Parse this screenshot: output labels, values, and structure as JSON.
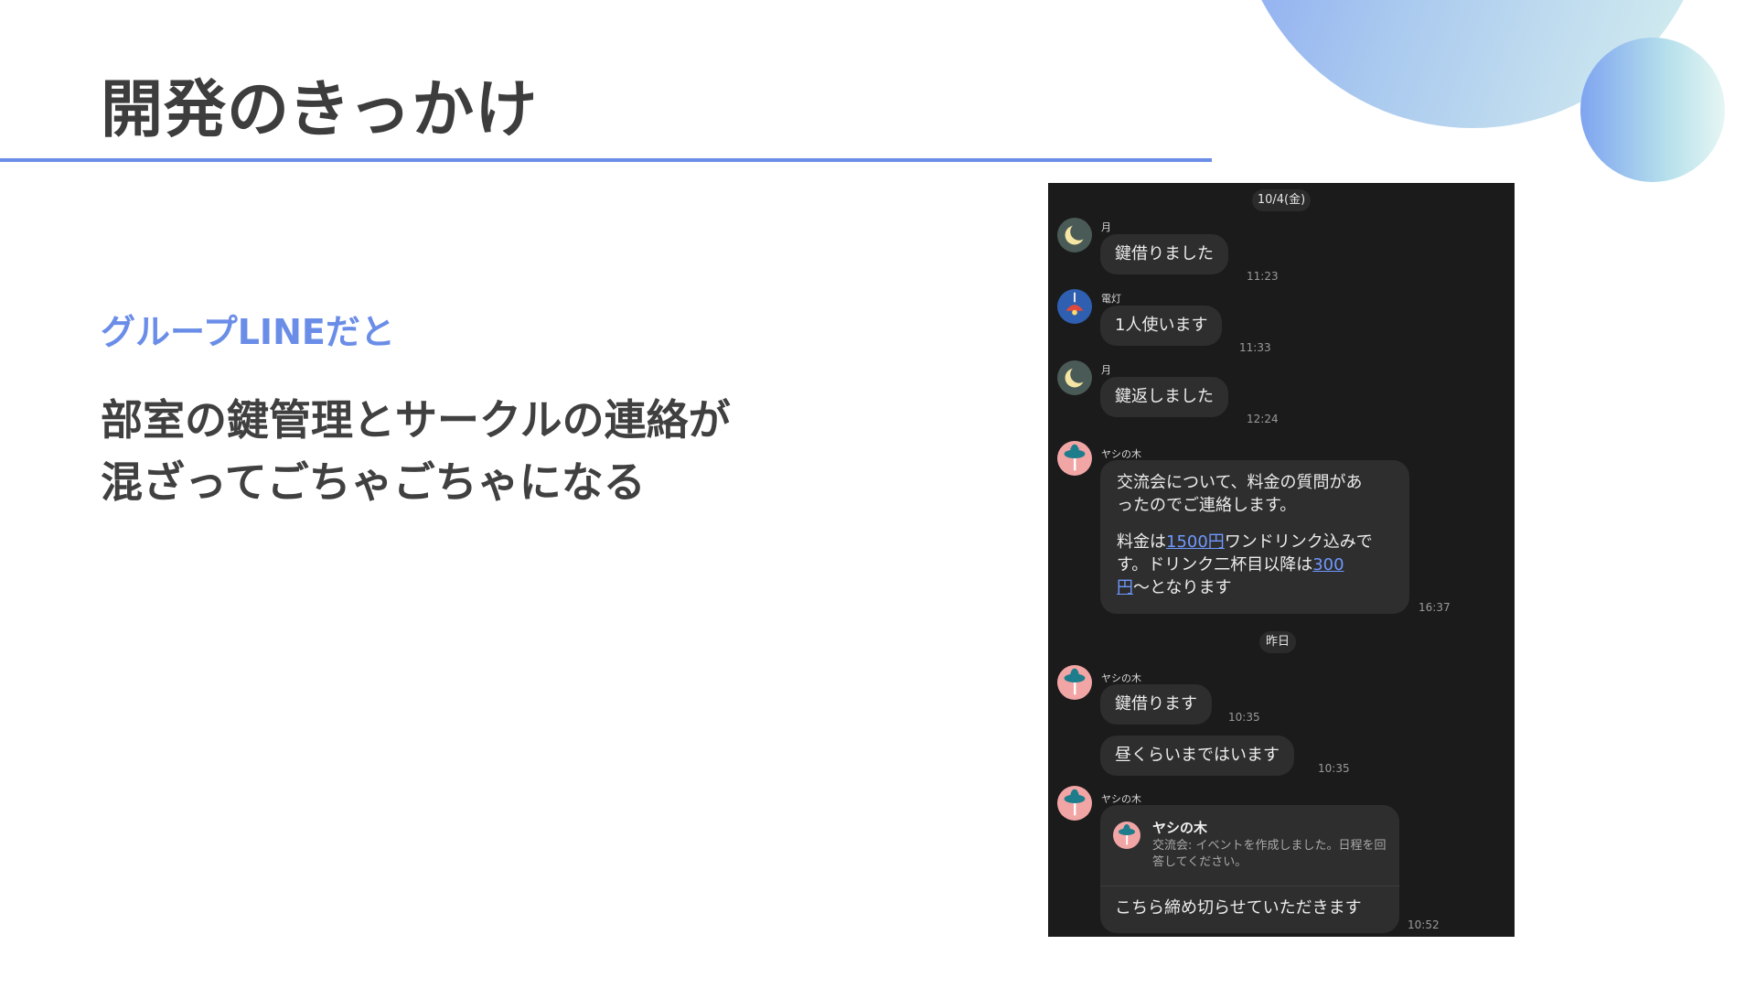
{
  "slide": {
    "title": "開発のきっかけ",
    "subtitle": "グループLINEだと",
    "body_lines": [
      "部室の鍵管理とサークルの連絡が",
      "混ざってごちゃごちゃになる"
    ]
  },
  "colors": {
    "accent": "#6a8de8",
    "chat_background": "#1b1b1b",
    "bubble": "#2e2e2e",
    "link": "#6f98ff"
  },
  "chat": {
    "date_separator_1": "10/4(金)",
    "date_separator_2": "昨日",
    "messages": [
      {
        "sender": "月",
        "avatar": "moon-icon",
        "text": "鍵借りました",
        "time": "11:23"
      },
      {
        "sender": "電灯",
        "avatar": "lamp-icon",
        "text": "1人使います",
        "time": "11:33"
      },
      {
        "sender": "月",
        "avatar": "moon-icon",
        "text": "鍵返しました",
        "time": "12:24"
      },
      {
        "sender": "ヤシの木",
        "avatar": "palm-tree-icon",
        "time": "16:37",
        "line1": "交流会について、料金の質問があ",
        "line2": "ったのでご連絡します。",
        "line3_pre": "料金は",
        "line3_link": "1500円",
        "line3_post": "ワンドリンク込みで",
        "line4_pre": "す。ドリンク二杯目以降は",
        "line4_link": "300",
        "line5_link": "円",
        "line5_post": "〜となります"
      },
      {
        "sender": "ヤシの木",
        "avatar": "palm-tree-icon",
        "text": "鍵借ります",
        "time": "10:35"
      },
      {
        "text": "昼くらいまではいます",
        "time": "10:35"
      },
      {
        "sender": "ヤシの木",
        "avatar": "palm-tree-icon",
        "time": "10:52",
        "card_title": "ヤシの木",
        "card_desc": "交流会: イベントを作成しました。日程を回答してください。",
        "text": "こちら締め切らせていただきます"
      }
    ]
  }
}
